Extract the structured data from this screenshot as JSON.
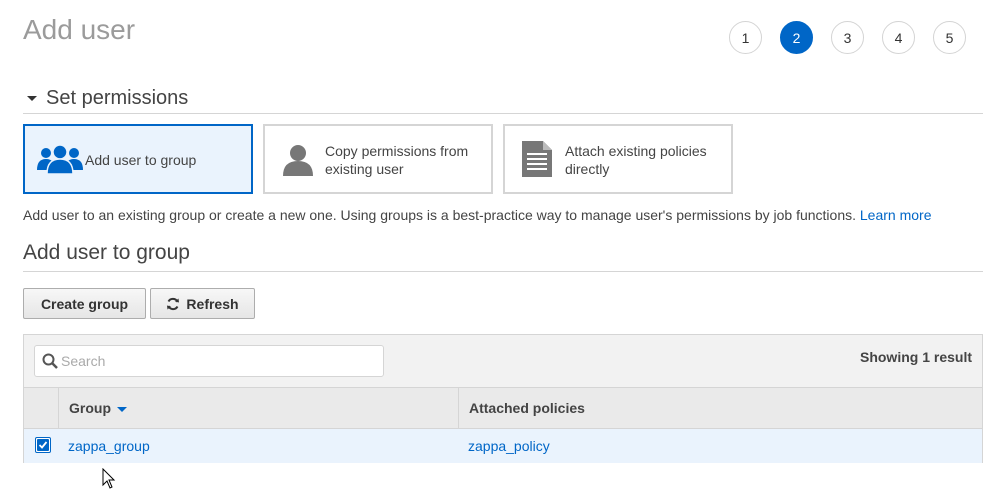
{
  "page": {
    "title": "Add user"
  },
  "steps": [
    {
      "label": "1",
      "active": false
    },
    {
      "label": "2",
      "active": true
    },
    {
      "label": "3",
      "active": false
    },
    {
      "label": "4",
      "active": false
    },
    {
      "label": "5",
      "active": false
    }
  ],
  "permissions": {
    "section_title": "Set permissions",
    "options": [
      {
        "label": "Add user to group",
        "icon": "users-group-icon",
        "selected": true
      },
      {
        "label": "Copy permissions from existing user",
        "icon": "user-icon",
        "selected": false
      },
      {
        "label": "Attach existing policies directly",
        "icon": "document-icon",
        "selected": false
      }
    ],
    "description": "Add user to an existing group or create a new one. Using groups is a best-practice way to manage user's permissions by job functions.",
    "learn_more": "Learn more"
  },
  "group_section": {
    "title": "Add user to group",
    "create_button": "Create group",
    "refresh_button": "Refresh"
  },
  "table": {
    "search_placeholder": "Search",
    "search_value": "",
    "result_count": "Showing 1 result",
    "columns": [
      "Group",
      "Attached policies"
    ],
    "rows": [
      {
        "checked": true,
        "group": "zappa_group",
        "policies": "zappa_policy"
      }
    ]
  },
  "colors": {
    "accent": "#0066c7",
    "selected_bg": "#eaf3fd",
    "title_gray": "#9b9b9b"
  }
}
